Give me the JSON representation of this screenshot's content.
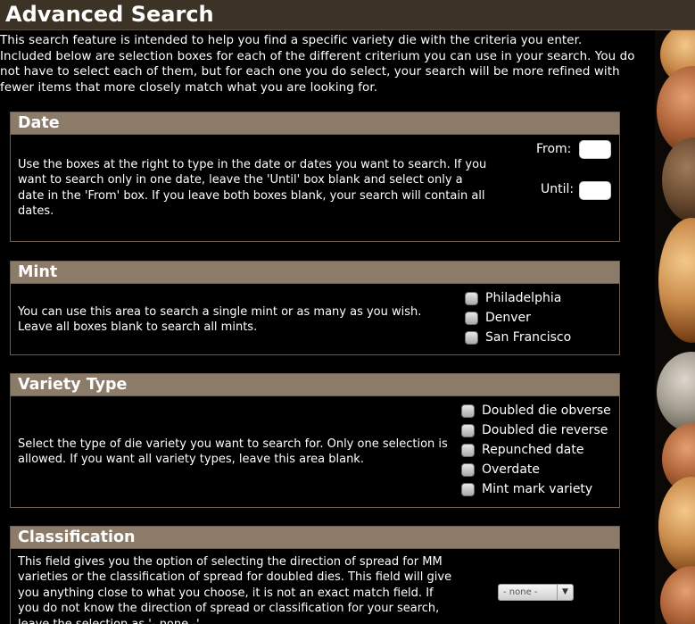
{
  "page": {
    "title": "Advanced Search",
    "intro": "This search feature is intended to help you find a specific variety die with the criteria you enter. Included below are selection boxes for each of the different criterium you can use in your search. You do not have to select each of them, but for each one you do select, your search will be more refined with fewer items that more closely match what you are looking for."
  },
  "date": {
    "heading": "Date",
    "description": "Use the boxes at the right to type in the date or dates you want to search. If you want to search only in one date, leave the 'Until' box blank and select only a date in the 'From' box. If you leave both boxes blank, your search will contain all dates.",
    "from_label": "From:",
    "from_value": "",
    "until_label": "Until:",
    "until_value": ""
  },
  "mint": {
    "heading": "Mint",
    "description": "You can use this area to search a single mint or as many as you wish. Leave all boxes blank to search all mints.",
    "options": [
      "Philadelphia",
      "Denver",
      "San Francisco"
    ]
  },
  "variety": {
    "heading": "Variety Type",
    "description": "Select the type of die variety you want to search for. Only one selection is allowed. If you want all variety types, leave this area blank.",
    "options": [
      "Doubled die obverse",
      "Doubled die reverse",
      "Repunched date",
      "Overdate",
      "Mint mark variety"
    ]
  },
  "classification": {
    "heading": "Classification",
    "description": "This field gives you the option of selecting the direction of spread for MM varieties or the classification of spread for doubled dies. This field will give you anything close to what you choose, it is not an exact match field. If you do not know the direction of spread or classification for your search, leave the selection as '- none -'.",
    "select_value": "- none -"
  },
  "colors": {
    "title_bar": "#3d3226",
    "panel_header": "#8c7b69",
    "background": "#000000"
  }
}
